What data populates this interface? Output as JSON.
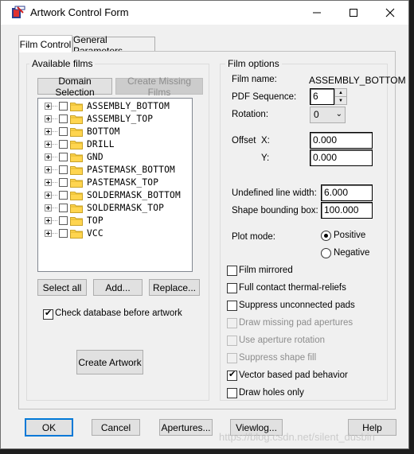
{
  "window": {
    "title": "Artwork Control Form"
  },
  "tabs": [
    {
      "label": "Film Control",
      "selected": true
    },
    {
      "label": "General Parameters",
      "selected": false
    }
  ],
  "available_films": {
    "label": "Available films",
    "domain_selection": "Domain Selection",
    "create_missing": "Create Missing Films",
    "films": [
      "ASSEMBLY_BOTTOM",
      "ASSEMBLY_TOP",
      "BOTTOM",
      "DRILL",
      "GND",
      "PASTEMASK_BOTTOM",
      "PASTEMASK_TOP",
      "SOLDERMASK_BOTTOM",
      "SOLDERMASK_TOP",
      "TOP",
      "VCC"
    ],
    "select_all": "Select all",
    "add": "Add...",
    "replace": "Replace...",
    "check_database": {
      "label": "Check database before artwork",
      "checked": true
    },
    "create_artwork": "Create Artwork"
  },
  "film_options": {
    "label": "Film options",
    "film_name_label": "Film name:",
    "film_name_value": "ASSEMBLY_BOTTOM",
    "pdf_sequence_label": "PDF Sequence:",
    "pdf_sequence_value": "6",
    "rotation_label": "Rotation:",
    "rotation_value": "0",
    "offset_label": "Offset",
    "x_label": "X:",
    "x_value": "0.000",
    "y_label": "Y:",
    "y_value": "0.000",
    "undefined_line_width_label": "Undefined line width:",
    "undefined_line_width_value": "6.000",
    "shape_bounding_box_label": "Shape bounding box:",
    "shape_bounding_box_value": "100.000",
    "plot_mode_label": "Plot mode:",
    "plot_mode_positive": "Positive",
    "plot_mode_negative": "Negative",
    "plot_mode_selected": "Positive",
    "options": [
      {
        "label": "Film mirrored",
        "checked": false,
        "enabled": true
      },
      {
        "label": "Full contact thermal-reliefs",
        "checked": false,
        "enabled": true
      },
      {
        "label": "Suppress unconnected pads",
        "checked": false,
        "enabled": true
      },
      {
        "label": "Draw missing pad apertures",
        "checked": false,
        "enabled": false
      },
      {
        "label": "Use aperture rotation",
        "checked": false,
        "enabled": false
      },
      {
        "label": "Suppress shape fill",
        "checked": false,
        "enabled": false
      },
      {
        "label": "Vector based pad behavior",
        "checked": true,
        "enabled": true
      },
      {
        "label": "Draw holes only",
        "checked": false,
        "enabled": true
      }
    ]
  },
  "footer": {
    "ok": "OK",
    "cancel": "Cancel",
    "apertures": "Apertures...",
    "viewlog": "Viewlog...",
    "help": "Help"
  },
  "watermark": "https://blog.csdn.net/silent_dusbin"
}
